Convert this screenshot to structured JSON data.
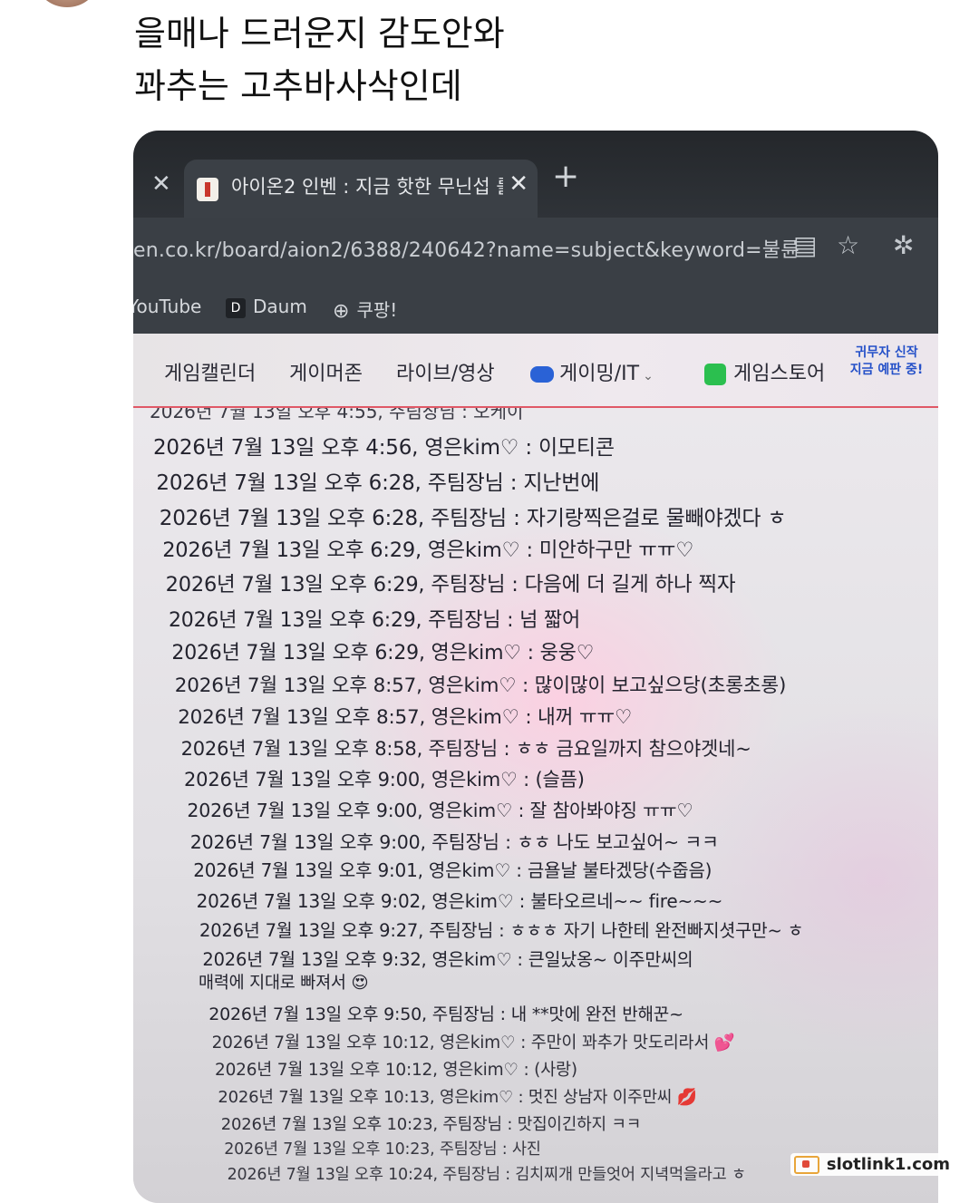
{
  "post": {
    "lines": [
      "을매나 드러운지 감도안와",
      "꽈추는 고추바사삭인데"
    ]
  },
  "browser": {
    "tab_title": "아이온2 인벤 : 지금 핫한 무닌섭 를",
    "tab_close": "✕",
    "prev_tab_close": "✕",
    "new_tab": "+",
    "url": "en.co.kr/board/aion2/6388/240642?name=subject&keyword=불륜",
    "bookmarks": [
      "YouTube",
      "Daum",
      "쿠팡!"
    ],
    "daum_icon": "D"
  },
  "site_nav": {
    "items": [
      "게임캘린더",
      "게이머존",
      "라이브/영상",
      "게이밍/IT",
      "게임스토어"
    ],
    "promo_lines": [
      "귀무자 신작",
      "지금 예판 중!"
    ]
  },
  "chat_log": {
    "cut_line": "2026년 7월 13일 오후 4:55, 주팀장님 : 오케이",
    "lines": [
      "2026년 7월 13일 오후 4:56, 영은kim♡ : 이모티콘",
      "2026년 7월 13일 오후 6:28, 주팀장님 : 지난번에",
      "2026년 7월 13일 오후 6:28, 주팀장님 : 자기랑찍은걸로 물빼야겠다 ㅎ",
      "2026년 7월 13일 오후 6:29, 영은kim♡ : 미안하구만 ㅠㅠ♡",
      "2026년 7월 13일 오후 6:29, 주팀장님 : 다음에 더 길게 하나 찍자",
      "2026년 7월 13일 오후 6:29, 주팀장님 : 넘 짧어",
      "2026년 7월 13일 오후 6:29, 영은kim♡ : 웅웅♡",
      "2026년 7월 13일 오후 8:57, 영은kim♡ : 많이많이 보고싶으당(초롱초롱)",
      "2026년 7월 13일 오후 8:57, 영은kim♡ : 내꺼 ㅠㅠ♡",
      "2026년 7월 13일 오후 8:58, 주팀장님 : ㅎㅎ 금요일까지 참으야겟네~",
      "2026년 7월 13일 오후 9:00, 영은kim♡ : (슬픔)",
      "2026년 7월 13일 오후 9:00, 영은kim♡ : 잘 참아봐야징 ㅠㅠ♡",
      "2026년 7월 13일 오후 9:00, 주팀장님 : ㅎㅎ 나도 보고싶어~ ㅋㅋ",
      "2026년 7월 13일 오후 9:01, 영은kim♡ : 금욜날 불타겠당(수줍음)",
      "2026년 7월 13일 오후 9:02, 영은kim♡ : 불타오르네~~ fire~~~",
      "2026년 7월 13일 오후 9:27, 주팀장님 : ㅎㅎㅎ 자기 나한테 완전빠지셧구만~ ㅎ",
      "2026년 7월 13일 오후 9:32, 영은kim♡ : 큰일났옹~ 이주만씨의",
      "매력에 지대로 빠져서 😍",
      "2026년 7월 13일 오후 9:50, 주팀장님 : 내 **맛에 완전 반해꾼~",
      "2026년 7월 13일 오후 10:12, 영은kim♡ : 주만이 꽈추가 맛도리라서 💕",
      "2026년 7월 13일 오후 10:12, 영은kim♡ : (사랑)",
      "2026년 7월 13일 오후 10:13, 영은kim♡ : 멋진 상남자 이주만씨 💋",
      "2026년 7월 13일 오후 10:23, 주팀장님 : 맛집이긴하지 ㅋㅋ",
      "2026년 7월 13일 오후 10:23, 주팀장님 : 사진",
      "2026년 7월 13일 오후 10:24, 주팀장님 : 김치찌개 만들엇어 지녁먹을라고 ㅎ"
    ]
  },
  "watermark": {
    "text": "slotlink1.com"
  }
}
